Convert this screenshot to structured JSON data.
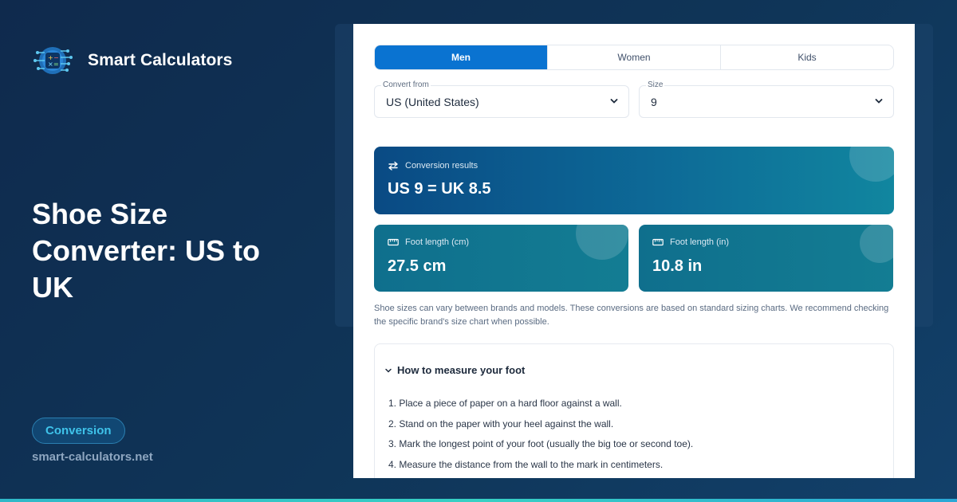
{
  "brand": {
    "name": "Smart Calculators"
  },
  "hero": {
    "title": "Shoe Size Converter: US to UK"
  },
  "tag": {
    "label": "Conversion"
  },
  "site": {
    "url": "smart-calculators.net"
  },
  "tabs": [
    {
      "label": "Men",
      "active": true
    },
    {
      "label": "Women",
      "active": false
    },
    {
      "label": "Kids",
      "active": false
    }
  ],
  "form": {
    "convert_from": {
      "label": "Convert from",
      "value": "US (United States)"
    },
    "size": {
      "label": "Size",
      "value": "9"
    }
  },
  "results": {
    "main": {
      "label": "Conversion results",
      "value": "US 9 = UK 8.5"
    },
    "foot_cm": {
      "label": "Foot length (cm)",
      "value": "27.5 cm"
    },
    "foot_in": {
      "label": "Foot length (in)",
      "value": "10.8 in"
    }
  },
  "disclaimer": "Shoe sizes can vary between brands and models. These conversions are based on standard sizing charts. We recommend checking the specific brand's size chart when possible.",
  "accordion": {
    "title": "How to measure your foot",
    "steps": [
      "1. Place a piece of paper on a hard floor against a wall.",
      "2. Stand on the paper with your heel against the wall.",
      "3. Mark the longest point of your foot (usually the big toe or second toe).",
      "4. Measure the distance from the wall to the mark in centimeters."
    ]
  },
  "colors": {
    "accent": "#0a73d1",
    "teal": "#137d93",
    "navy": "#0f2a4d",
    "tag_text": "#3fc3ea"
  },
  "icons": {
    "logo": "calculator-circuit-logo",
    "swap": "swap-arrows-icon",
    "ruler": "ruler-icon",
    "chevron": "chevron-down-icon"
  }
}
